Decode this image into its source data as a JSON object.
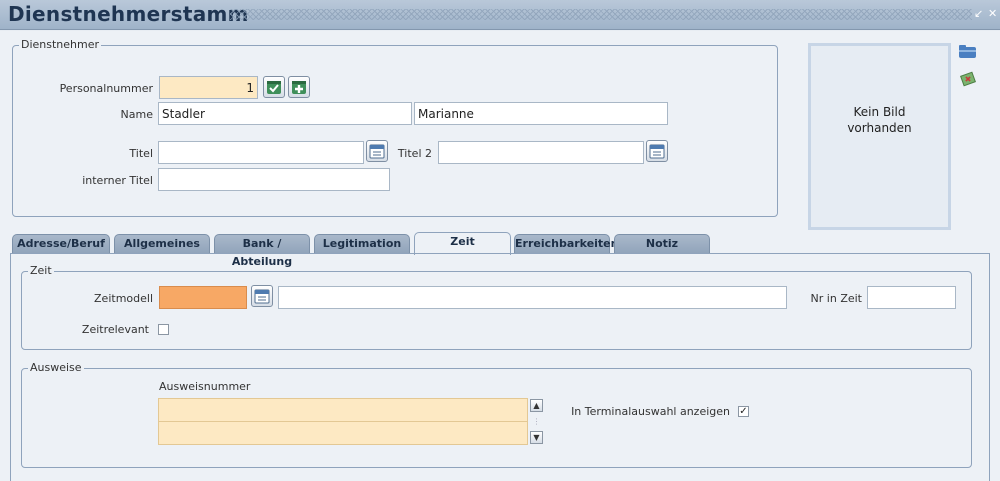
{
  "window": {
    "title": "Dienstnehmerstamm"
  },
  "dienstnehmer": {
    "legend": "Dienstnehmer",
    "personalnummer_label": "Personalnummer",
    "personalnummer_value": "1",
    "name_label": "Name",
    "nachname": "Stadler",
    "vorname": "Marianne",
    "titel_label": "Titel",
    "titel_value": "",
    "titel2_label": "Titel 2",
    "titel2_value": "",
    "interner_titel_label": "interner Titel",
    "interner_titel_value": ""
  },
  "photo": {
    "line1": "Kein Bild",
    "line2": "vorhanden"
  },
  "tabs": [
    {
      "label": "Adresse/Beruf"
    },
    {
      "label": "Allgemeines"
    },
    {
      "label": "Bank / Abteilung"
    },
    {
      "label": "Legitimation"
    },
    {
      "label": "Zeit",
      "active": true
    },
    {
      "label": "Erreichbarkeiten"
    },
    {
      "label": "Notiz"
    }
  ],
  "zeit": {
    "legend": "Zeit",
    "zeitmodell_label": "Zeitmodell",
    "zeitmodell_value": "",
    "zeitmodell_desc": "",
    "nr_in_zeit_label": "Nr in Zeit",
    "nr_in_zeit_value": "",
    "zeitrelevant_label": "Zeitrelevant",
    "zeitrelevant_checked": false
  },
  "ausweise": {
    "legend": "Ausweise",
    "column_header": "Ausweisnummer",
    "rows": [
      "",
      ""
    ],
    "terminal_label": "In Terminalauswahl anzeigen",
    "terminal_checked": true
  },
  "colors": {
    "accent": "#9fb3c9",
    "mandatory": "#fde9c3",
    "highlight": "#f7a865"
  }
}
